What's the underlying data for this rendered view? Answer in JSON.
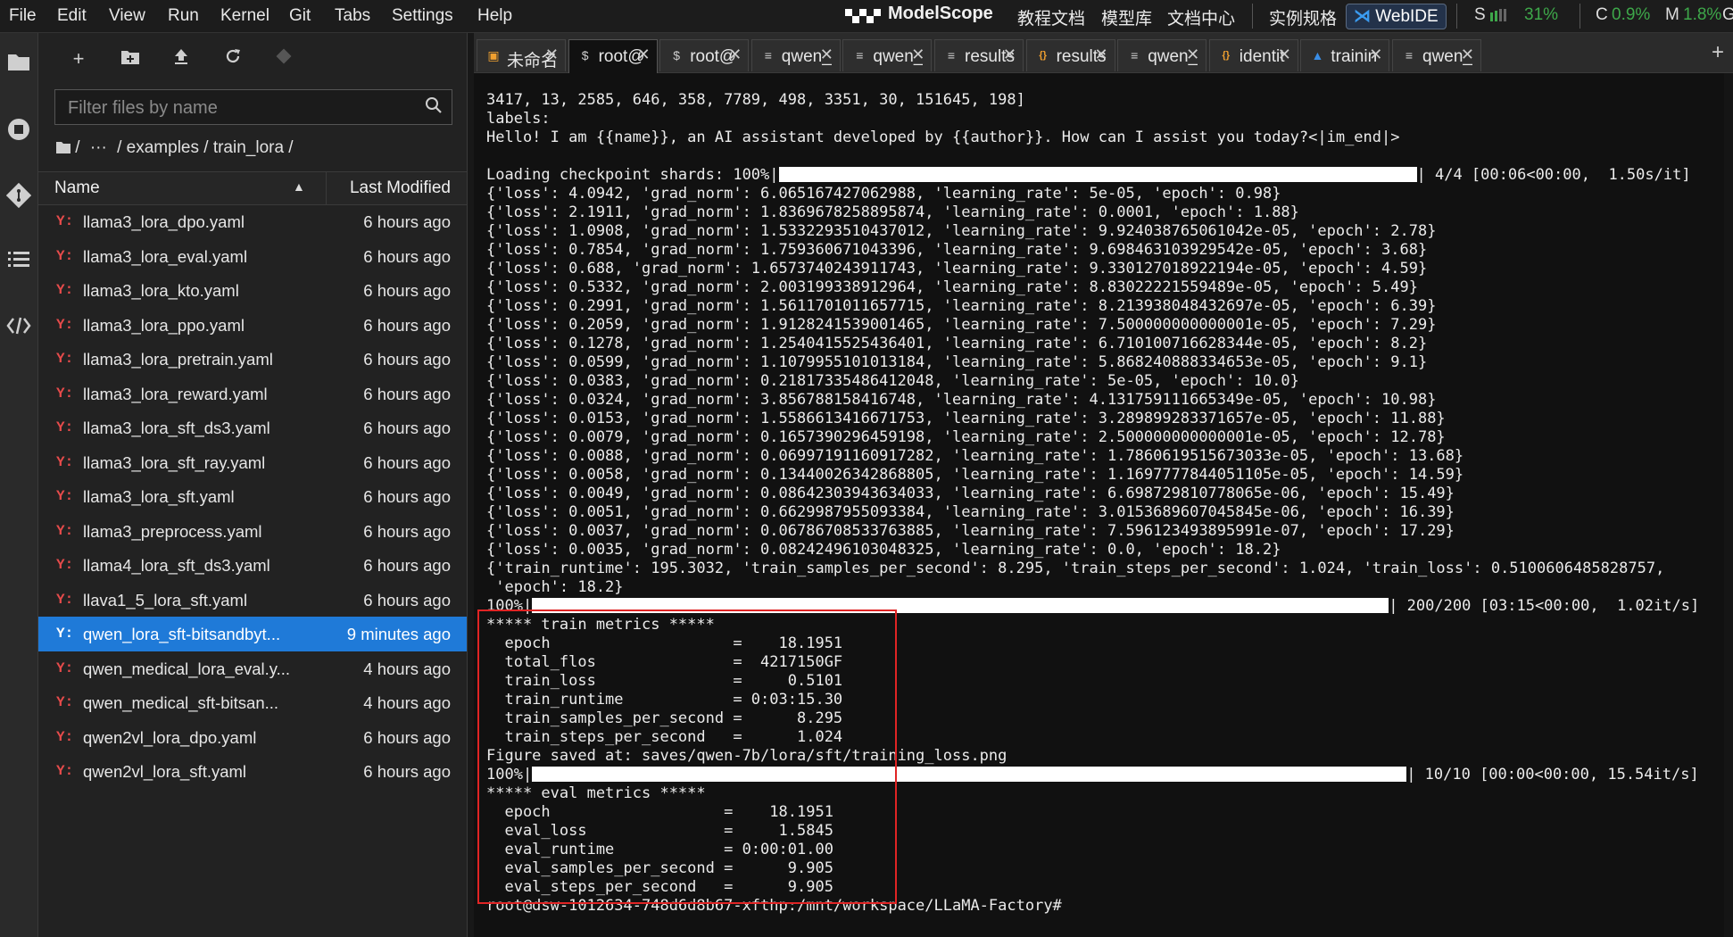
{
  "menubar": {
    "items": [
      "File",
      "Edit",
      "View",
      "Run",
      "Kernel",
      "Git",
      "Tabs",
      "Settings",
      "Help"
    ],
    "brand": "ModelScope",
    "links": [
      "教程文档",
      "模型库",
      "文档中心",
      "实例规格"
    ],
    "webide": "WebIDE",
    "stats": {
      "s_label": "S",
      "s_value": "31%",
      "c_label": "C",
      "c_value": "0.9%",
      "m_label": "M",
      "m_value": "1.8%",
      "g_label": "G"
    }
  },
  "colors": {
    "accent": "#1f7ad8",
    "yaml_icon": "#e64b4b",
    "highlight_box": "#e02424",
    "stat_green": "#3ea84a"
  },
  "rail": {
    "icons": [
      "folder-icon",
      "running-icon",
      "git-icon",
      "toc-icon",
      "code-icon"
    ]
  },
  "filebrowser": {
    "filter_placeholder": "Filter files by name",
    "breadcrumb": {
      "root": "/",
      "ellipsis": "···",
      "path": "/ examples / train_lora /"
    },
    "columns": {
      "name": "Name",
      "modified": "Last Modified"
    },
    "files": [
      {
        "name": "llama3_lora_dpo.yaml",
        "modified": "6 hours ago"
      },
      {
        "name": "llama3_lora_eval.yaml",
        "modified": "6 hours ago"
      },
      {
        "name": "llama3_lora_kto.yaml",
        "modified": "6 hours ago"
      },
      {
        "name": "llama3_lora_ppo.yaml",
        "modified": "6 hours ago"
      },
      {
        "name": "llama3_lora_pretrain.yaml",
        "modified": "6 hours ago"
      },
      {
        "name": "llama3_lora_reward.yaml",
        "modified": "6 hours ago"
      },
      {
        "name": "llama3_lora_sft_ds3.yaml",
        "modified": "6 hours ago"
      },
      {
        "name": "llama3_lora_sft_ray.yaml",
        "modified": "6 hours ago"
      },
      {
        "name": "llama3_lora_sft.yaml",
        "modified": "6 hours ago"
      },
      {
        "name": "llama3_preprocess.yaml",
        "modified": "6 hours ago"
      },
      {
        "name": "llama4_lora_sft_ds3.yaml",
        "modified": "6 hours ago"
      },
      {
        "name": "llava1_5_lora_sft.yaml",
        "modified": "6 hours ago"
      },
      {
        "name": "qwen_lora_sft-bitsandbyt...",
        "modified": "9 minutes ago",
        "selected": true
      },
      {
        "name": "qwen_medical_lora_eval.y...",
        "modified": "4 hours ago"
      },
      {
        "name": "qwen_medical_sft-bitsan...",
        "modified": "4 hours ago"
      },
      {
        "name": "qwen2vl_lora_dpo.yaml",
        "modified": "6 hours ago"
      },
      {
        "name": "qwen2vl_lora_sft.yaml",
        "modified": "6 hours ago"
      }
    ]
  },
  "tabs": [
    {
      "label": "未命名",
      "icon": "notebook-icon",
      "icon_color": "#f0a030"
    },
    {
      "label": "root@",
      "icon": "terminal-icon",
      "icon_color": "#cccccc",
      "active": true
    },
    {
      "label": "root@",
      "icon": "terminal-icon",
      "icon_color": "#cccccc"
    },
    {
      "label": "qwen_",
      "icon": "text-file-icon",
      "icon_color": "#cccccc"
    },
    {
      "label": "qwen_",
      "icon": "text-file-icon",
      "icon_color": "#cccccc"
    },
    {
      "label": "results",
      "icon": "text-file-icon",
      "icon_color": "#cccccc"
    },
    {
      "label": "results",
      "icon": "json-icon",
      "icon_color": "#f0a030"
    },
    {
      "label": "qwen_",
      "icon": "text-file-icon",
      "icon_color": "#cccccc"
    },
    {
      "label": "identit",
      "icon": "json-icon",
      "icon_color": "#f0a030"
    },
    {
      "label": "trainin",
      "icon": "image-icon",
      "icon_color": "#3a8ee6"
    },
    {
      "label": "qwen_",
      "icon": "text-file-icon",
      "icon_color": "#cccccc"
    }
  ],
  "terminal": {
    "lines_top": [
      "3417, 13, 2585, 646, 358, 7789, 498, 3351, 30, 151645, 198]",
      "labels:",
      "Hello! I am {{name}}, an AI assistant developed by {{author}}. How can I assist you today?<|im_end|>",
      ""
    ],
    "progress1": {
      "prefix": "Loading checkpoint shards: 100%|",
      "suffix": "| 4/4 [00:06<00:00,  1.50s/it]",
      "fraction": 1.0
    },
    "lines_mid": [
      "{'loss': 4.0942, 'grad_norm': 6.065167427062988, 'learning_rate': 5e-05, 'epoch': 0.98}",
      "{'loss': 2.1911, 'grad_norm': 1.8369678258895874, 'learning_rate': 0.0001, 'epoch': 1.88}",
      "{'loss': 1.0908, 'grad_norm': 1.5332293510437012, 'learning_rate': 9.924038765061042e-05, 'epoch': 2.78}",
      "{'loss': 0.7854, 'grad_norm': 1.759360671043396, 'learning_rate': 9.698463103929542e-05, 'epoch': 3.68}",
      "{'loss': 0.688, 'grad_norm': 1.6573740243911743, 'learning_rate': 9.330127018922194e-05, 'epoch': 4.59}",
      "{'loss': 0.5332, 'grad_norm': 2.003199338912964, 'learning_rate': 8.83022221559489e-05, 'epoch': 5.49}",
      "{'loss': 0.2991, 'grad_norm': 1.5611701011657715, 'learning_rate': 8.213938048432697e-05, 'epoch': 6.39}",
      "{'loss': 0.2059, 'grad_norm': 1.9128241539001465, 'learning_rate': 7.500000000000001e-05, 'epoch': 7.29}",
      "{'loss': 0.1278, 'grad_norm': 1.2540415525436401, 'learning_rate': 6.710100716628344e-05, 'epoch': 8.2}",
      "{'loss': 0.0599, 'grad_norm': 1.1079955101013184, 'learning_rate': 5.868240888334653e-05, 'epoch': 9.1}",
      "{'loss': 0.0383, 'grad_norm': 0.21817335486412048, 'learning_rate': 5e-05, 'epoch': 10.0}",
      "{'loss': 0.0324, 'grad_norm': 3.856788158416748, 'learning_rate': 4.131759111665349e-05, 'epoch': 10.98}",
      "{'loss': 0.0153, 'grad_norm': 1.5586613416671753, 'learning_rate': 3.289899283371657e-05, 'epoch': 11.88}",
      "{'loss': 0.0079, 'grad_norm': 0.1657390296459198, 'learning_rate': 2.500000000000001e-05, 'epoch': 12.78}",
      "{'loss': 0.0088, 'grad_norm': 0.06997191160917282, 'learning_rate': 1.7860619515673033e-05, 'epoch': 13.68}",
      "{'loss': 0.0058, 'grad_norm': 0.13440026342868805, 'learning_rate': 1.1697777844051105e-05, 'epoch': 14.59}",
      "{'loss': 0.0049, 'grad_norm': 0.08642303943634033, 'learning_rate': 6.698729810778065e-06, 'epoch': 15.49}",
      "{'loss': 0.0051, 'grad_norm': 0.6629987955093384, 'learning_rate': 3.0153689607045845e-06, 'epoch': 16.39}",
      "{'loss': 0.0037, 'grad_norm': 0.06786708533763885, 'learning_rate': 7.596123493895991e-07, 'epoch': 17.29}",
      "{'loss': 0.0035, 'grad_norm': 0.08242496103048325, 'learning_rate': 0.0, 'epoch': 18.2}",
      "{'train_runtime': 195.3032, 'train_samples_per_second': 8.295, 'train_steps_per_second': 1.024, 'train_loss': 0.5100606485828757,",
      " 'epoch': 18.2}"
    ],
    "progress2": {
      "prefix": "100%|",
      "suffix": "| 200/200 [03:15<00:00,  1.02it/s]",
      "fraction": 1.0
    },
    "lines_train": [
      "***** train metrics *****",
      "  epoch                    =    18.1951",
      "  total_flos               =  4217150GF",
      "  train_loss               =     0.5101",
      "  train_runtime            = 0:03:15.30",
      "  train_samples_per_second =      8.295",
      "  train_steps_per_second   =      1.024",
      "Figure saved at: saves/qwen-7b/lora/sft/training_loss.png"
    ],
    "progress3": {
      "prefix": "100%|",
      "suffix": "| 10/10 [00:00<00:00, 15.54it/s]",
      "fraction": 1.0
    },
    "lines_eval": [
      "***** eval metrics *****",
      "  epoch                   =    18.1951",
      "  eval_loss               =     1.5845",
      "  eval_runtime            = 0:00:01.00",
      "  eval_samples_per_second =      9.905",
      "  eval_steps_per_second   =      9.905",
      "root@dsw-1012634-748d6d8b67-xfthp:/mnt/workspace/LLaMA-Factory#"
    ]
  }
}
